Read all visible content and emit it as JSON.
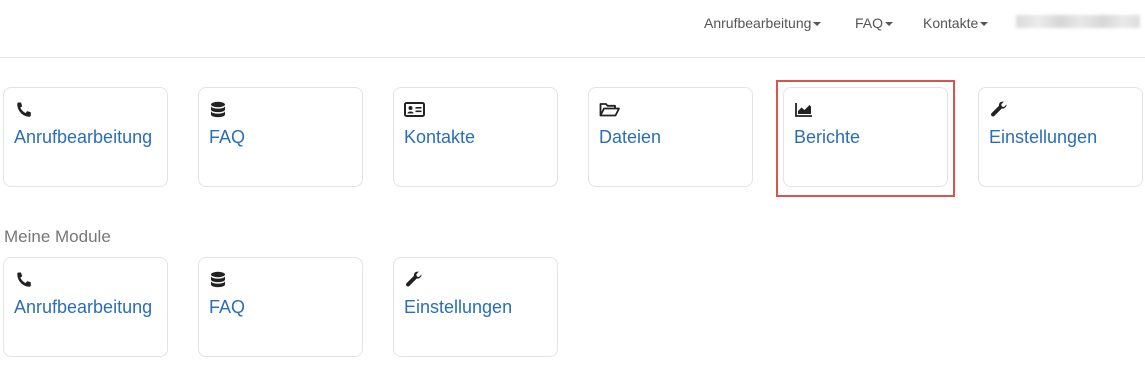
{
  "nav": {
    "items": [
      {
        "label": "Anrufbearbeitung"
      },
      {
        "label": "FAQ"
      },
      {
        "label": "Kontakte"
      }
    ]
  },
  "modules": [
    {
      "label": "Anrufbearbeitung",
      "icon": "phone-icon"
    },
    {
      "label": "FAQ",
      "icon": "database-icon"
    },
    {
      "label": "Kontakte",
      "icon": "address-card-icon"
    },
    {
      "label": "Dateien",
      "icon": "folder-open-icon"
    },
    {
      "label": "Berichte",
      "icon": "area-chart-icon"
    },
    {
      "label": "Einstellungen",
      "icon": "wrench-icon"
    }
  ],
  "my_modules": {
    "title": "Meine Module",
    "items": [
      {
        "label": "Anrufbearbeitung",
        "icon": "phone-icon"
      },
      {
        "label": "FAQ",
        "icon": "database-icon"
      },
      {
        "label": "Einstellungen",
        "icon": "wrench-icon"
      }
    ]
  },
  "colors": {
    "link": "#2a6fb5",
    "highlight": "#d9534f"
  }
}
